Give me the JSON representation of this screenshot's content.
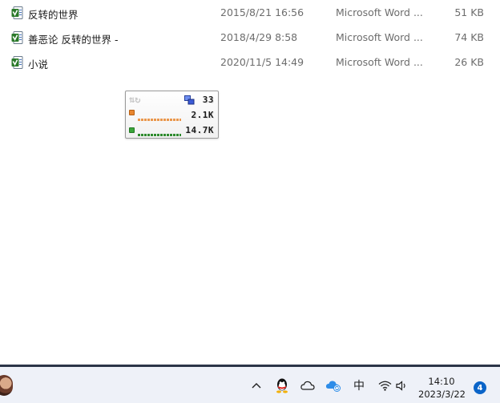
{
  "files": [
    {
      "name": "反转的世界",
      "modified": "2015/8/21 16:56",
      "type": "Microsoft Word ...",
      "size": "51 KB",
      "icon": "word-document-icon"
    },
    {
      "name": "善恶论 反转的世界 -",
      "modified": "2018/4/29 8:58",
      "type": "Microsoft Word ...",
      "size": "74 KB",
      "icon": "word-document-icon"
    },
    {
      "name": "小说",
      "modified": "2020/11/5 14:49",
      "type": "Microsoft Word ...",
      "size": "26 KB",
      "icon": "word-document-icon"
    }
  ],
  "net_monitor": {
    "connections": "33",
    "upload": "2.1K",
    "download": "14.7K",
    "colors": {
      "upload": "#e8862e",
      "download": "#3aa53a",
      "connections": "#3b5bd6"
    }
  },
  "taskbar": {
    "ime_label": "中",
    "time": "14:10",
    "date": "2023/3/22",
    "notification_count": "4",
    "icons": [
      "chevron-up-icon",
      "qq-icon",
      "onedrive-cloud-icon",
      "cloud-sync-icon",
      "ime-icon",
      "wifi-icon",
      "volume-icon"
    ],
    "accent_color": "#0a64c8"
  }
}
